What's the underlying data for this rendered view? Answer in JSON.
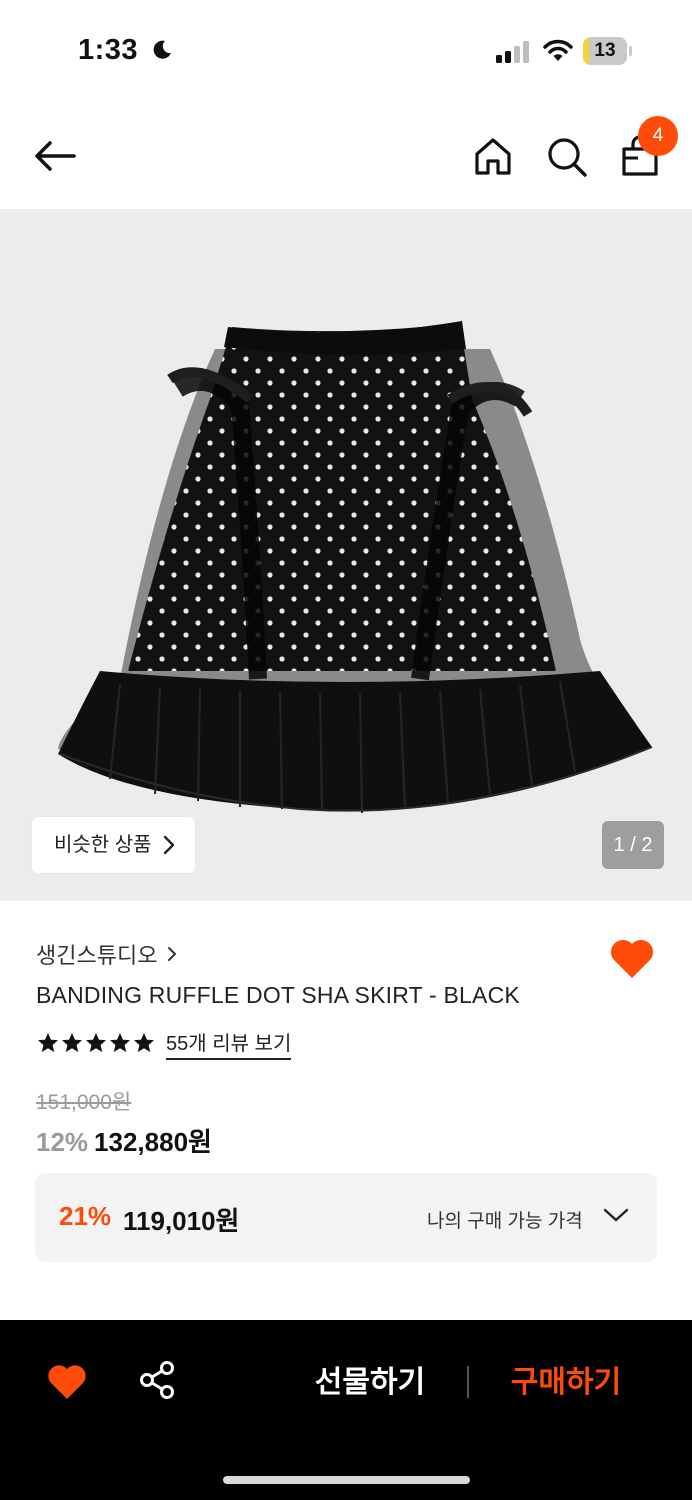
{
  "status": {
    "time": "1:33",
    "battery": "13",
    "battery_level": 0.13
  },
  "nav": {
    "cart_count": "4"
  },
  "hero": {
    "similar_label": "비슷한 상품",
    "page_indicator": "1 / 2"
  },
  "product": {
    "brand": "생긴스튜디오",
    "name": "BANDING RUFFLE DOT SHA SKIRT - BLACK",
    "rating_stars": 5,
    "review_link": "55개 리뷰 보기",
    "original_price": "151,000원",
    "discount_rate": "12%",
    "sale_price": "132,880원"
  },
  "my_price": {
    "rate": "21%",
    "price": "119,010원",
    "label": "나의 구매 가능 가격"
  },
  "bottom_bar": {
    "gift_label": "선물하기",
    "buy_label": "구매하기"
  },
  "colors": {
    "accent": "#ff4b0a",
    "hero_bg": "#ececec",
    "bottom_bar_bg": "#000000"
  },
  "icons": [
    "moon-icon",
    "signal-icon",
    "wifi-icon",
    "back-arrow-icon",
    "home-icon",
    "search-icon",
    "shopping-bag-icon",
    "chevron-right-icon",
    "heart-icon",
    "star-icon",
    "chevron-down-icon",
    "share-icon"
  ]
}
